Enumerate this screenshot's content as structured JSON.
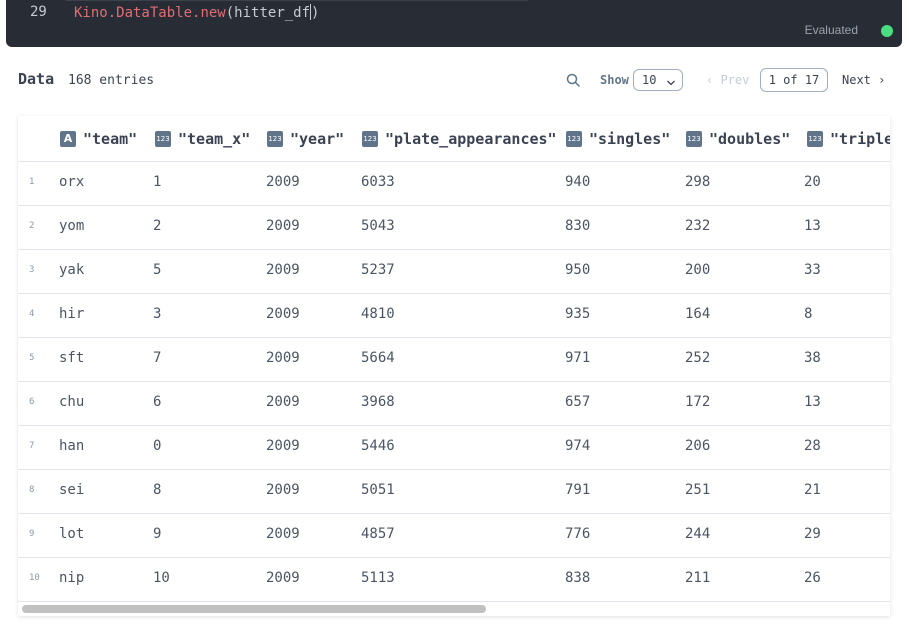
{
  "code_cell": {
    "line_number": "29",
    "code_module": "Kino.DataTable",
    "code_call": ".new",
    "code_open": "(",
    "code_arg": "hitter_df",
    "code_close": ")",
    "status": "Evaluated",
    "status_color": "#4ade80"
  },
  "toolbar": {
    "title": "Data",
    "entries": "168 entries",
    "search_icon": "search-icon",
    "show_label": "Show",
    "page_size": "10",
    "prev_label": "‹ Prev",
    "page_indicator": "1 of 17",
    "next_label": "Next ›"
  },
  "table": {
    "columns": [
      {
        "name": "\"team\"",
        "type_badge": "A"
      },
      {
        "name": "\"team_x\"",
        "type_badge": "123"
      },
      {
        "name": "\"year\"",
        "type_badge": "123"
      },
      {
        "name": "\"plate_appearances\"",
        "type_badge": "123"
      },
      {
        "name": "\"singles\"",
        "type_badge": "123"
      },
      {
        "name": "\"doubles\"",
        "type_badge": "123"
      },
      {
        "name": "\"triple",
        "type_badge": "123"
      }
    ],
    "rows": [
      {
        "idx": "1",
        "cells": [
          "orx",
          "1",
          "2009",
          "6033",
          "940",
          "298",
          "20"
        ]
      },
      {
        "idx": "2",
        "cells": [
          "yom",
          "2",
          "2009",
          "5043",
          "830",
          "232",
          "13"
        ]
      },
      {
        "idx": "3",
        "cells": [
          "yak",
          "5",
          "2009",
          "5237",
          "950",
          "200",
          "33"
        ]
      },
      {
        "idx": "4",
        "cells": [
          "hir",
          "3",
          "2009",
          "4810",
          "935",
          "164",
          "8"
        ]
      },
      {
        "idx": "5",
        "cells": [
          "sft",
          "7",
          "2009",
          "5664",
          "971",
          "252",
          "38"
        ]
      },
      {
        "idx": "6",
        "cells": [
          "chu",
          "6",
          "2009",
          "3968",
          "657",
          "172",
          "13"
        ]
      },
      {
        "idx": "7",
        "cells": [
          "han",
          "0",
          "2009",
          "5446",
          "974",
          "206",
          "28"
        ]
      },
      {
        "idx": "8",
        "cells": [
          "sei",
          "8",
          "2009",
          "5051",
          "791",
          "251",
          "21"
        ]
      },
      {
        "idx": "9",
        "cells": [
          "lot",
          "9",
          "2009",
          "4857",
          "776",
          "244",
          "29"
        ]
      },
      {
        "idx": "10",
        "cells": [
          "nip",
          "10",
          "2009",
          "5113",
          "838",
          "211",
          "26"
        ]
      }
    ]
  }
}
